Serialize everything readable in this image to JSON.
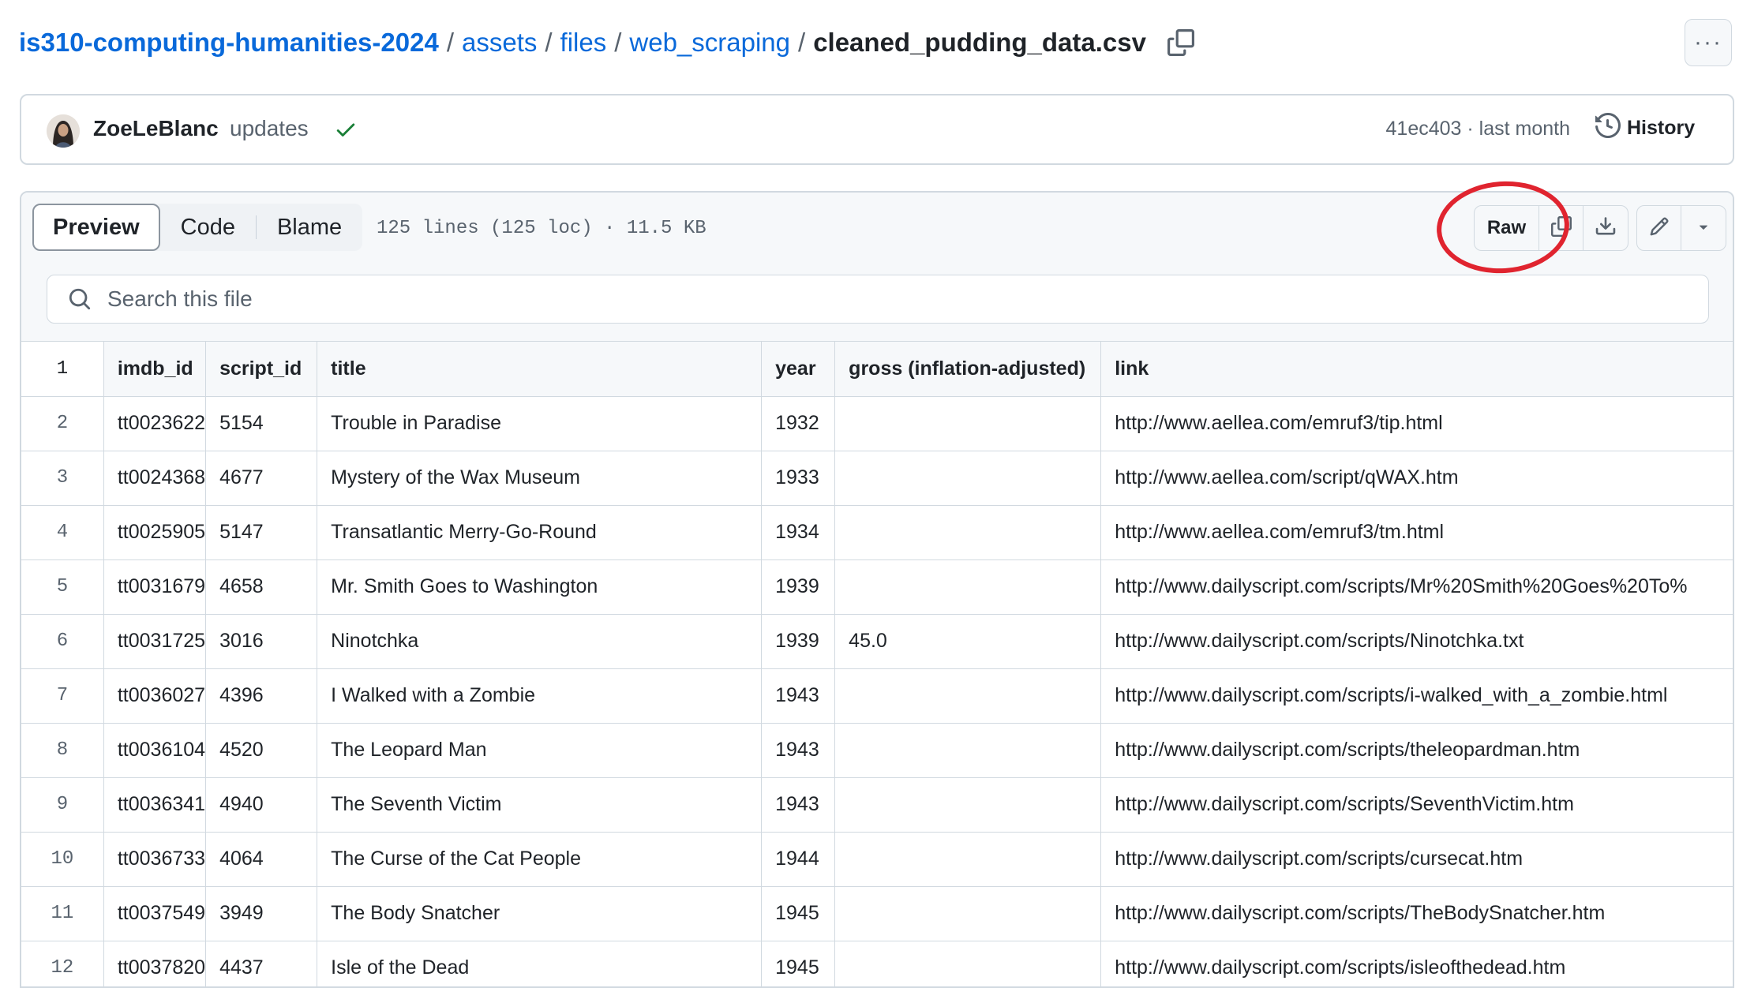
{
  "breadcrumb": {
    "repo": "is310-computing-humanities-2024",
    "segments": [
      "assets",
      "files",
      "web_scraping"
    ],
    "file": "cleaned_pudding_data.csv",
    "separator": "/"
  },
  "more_menu": {
    "label": "···"
  },
  "commit": {
    "author": "ZoeLeBlanc",
    "message": "updates",
    "meta": "41ec403 · last month",
    "history_label": "History",
    "status_color": "#1a7f37"
  },
  "file_header": {
    "tabs": [
      "Preview",
      "Code",
      "Blame"
    ],
    "active_tab": "Preview",
    "info": "125 lines (125 loc) · 11.5 KB",
    "raw_label": "Raw"
  },
  "search": {
    "placeholder": "Search this file"
  },
  "annotation_color": "#e0242f",
  "table": {
    "headers": [
      "imdb_id",
      "script_id",
      "title",
      "year",
      "gross (inflation-adjusted)",
      "link"
    ],
    "header_line": "1",
    "rows": [
      {
        "ln": "2",
        "cells": [
          "tt0023622",
          "5154",
          "Trouble in Paradise",
          "1932",
          "",
          "http://www.aellea.com/emruf3/tip.html"
        ]
      },
      {
        "ln": "3",
        "cells": [
          "tt0024368",
          "4677",
          "Mystery of the Wax Museum",
          "1933",
          "",
          "http://www.aellea.com/script/qWAX.htm"
        ]
      },
      {
        "ln": "4",
        "cells": [
          "tt0025905",
          "5147",
          "Transatlantic Merry-Go-Round",
          "1934",
          "",
          "http://www.aellea.com/emruf3/tm.html"
        ]
      },
      {
        "ln": "5",
        "cells": [
          "tt0031679",
          "4658",
          "Mr. Smith Goes to Washington",
          "1939",
          "",
          "http://www.dailyscript.com/scripts/Mr%20Smith%20Goes%20To%"
        ]
      },
      {
        "ln": "6",
        "cells": [
          "tt0031725",
          "3016",
          "Ninotchka",
          "1939",
          "45.0",
          "http://www.dailyscript.com/scripts/Ninotchka.txt"
        ]
      },
      {
        "ln": "7",
        "cells": [
          "tt0036027",
          "4396",
          "I Walked with a Zombie",
          "1943",
          "",
          "http://www.dailyscript.com/scripts/i-walked_with_a_zombie.html"
        ]
      },
      {
        "ln": "8",
        "cells": [
          "tt0036104",
          "4520",
          "The Leopard Man",
          "1943",
          "",
          "http://www.dailyscript.com/scripts/theleopardman.htm"
        ]
      },
      {
        "ln": "9",
        "cells": [
          "tt0036341",
          "4940",
          "The Seventh Victim",
          "1943",
          "",
          "http://www.dailyscript.com/scripts/SeventhVictim.htm"
        ]
      },
      {
        "ln": "10",
        "cells": [
          "tt0036733",
          "4064",
          "The Curse of the Cat People",
          "1944",
          "",
          "http://www.dailyscript.com/scripts/cursecat.htm"
        ]
      },
      {
        "ln": "11",
        "cells": [
          "tt0037549",
          "3949",
          "The Body Snatcher",
          "1945",
          "",
          "http://www.dailyscript.com/scripts/TheBodySnatcher.htm"
        ]
      },
      {
        "ln": "12",
        "cells": [
          "tt0037820",
          "4437",
          "Isle of the Dead",
          "1945",
          "",
          "http://www.dailyscript.com/scripts/isleofthedead.htm"
        ]
      }
    ]
  }
}
